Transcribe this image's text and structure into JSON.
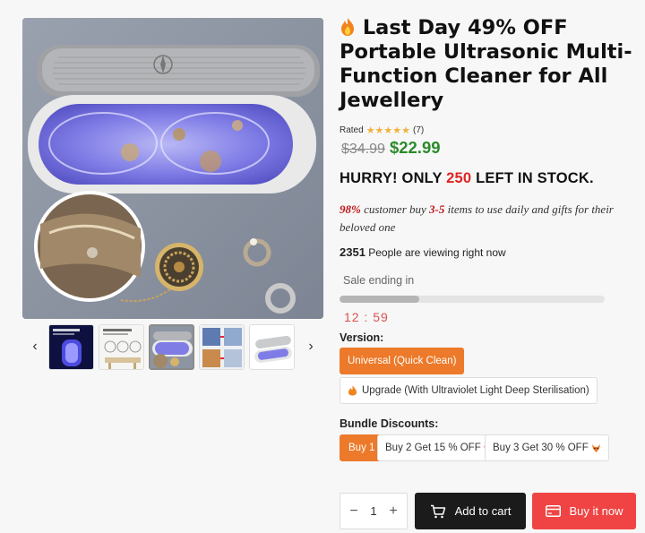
{
  "product": {
    "title": "Last Day 49% OFF Portable Ultrasonic Multi-Function Cleaner for All Jewellery",
    "rated_label": "Rated",
    "stars": "★★★★★",
    "review_count": "(7)",
    "rating_value": 5,
    "old_price": "$34.99",
    "new_price": "$22.99"
  },
  "stock": {
    "prefix": "HURRY! ONLY ",
    "count": "250",
    "suffix": " LEFT IN STOCK."
  },
  "customer_line": {
    "percent": "98%",
    "text_a": " customer buy ",
    "range": "3-5",
    "text_b": " items to use daily and gifts for their beloved one"
  },
  "viewing": {
    "count": "2351",
    "text": " People are viewing right now"
  },
  "sale": {
    "label": "Sale ending in",
    "progress": 0.3,
    "timer": "12 : 59"
  },
  "version": {
    "label": "Version:",
    "options": [
      {
        "label": "Universal (Quick Clean)",
        "selected": true
      },
      {
        "label": "Upgrade (With Ultraviolet Light Deep Sterilisation)",
        "selected": false
      }
    ]
  },
  "bundle": {
    "label": "Bundle Discounts:",
    "options": [
      {
        "label": "Buy 1",
        "selected": true
      },
      {
        "label": "Buy 2 Get 15 % OFF",
        "selected": false,
        "icon": "gift-icon"
      },
      {
        "label": "Buy 3 Get 30 % OFF",
        "selected": false,
        "icon": "fox-icon"
      }
    ]
  },
  "cart": {
    "quantity": "1",
    "minus": "−",
    "plus": "+",
    "add_label": "Add to cart",
    "buy_label": "Buy it now"
  },
  "gallery": {
    "prev": "‹",
    "next": "›",
    "active_index": 2
  },
  "colors": {
    "accent_orange": "#ec7a2a",
    "buy_red": "#f04444",
    "price_green": "#2b8a2b",
    "stock_red": "#e02424"
  }
}
